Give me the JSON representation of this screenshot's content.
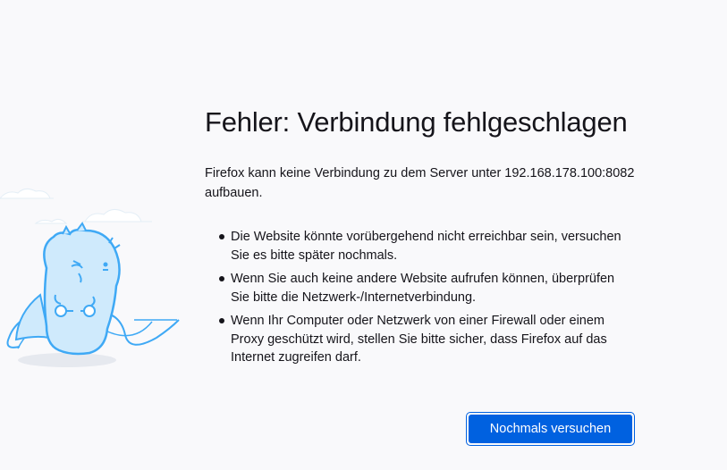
{
  "error": {
    "title": "Fehler: Verbindung fehlgeschlagen",
    "description": "Firefox kann keine Verbindung zu dem Server unter 192.168.178.100:8082 aufbauen.",
    "suggestions": [
      "Die Website könnte vorübergehend nicht erreichbar sein, versuchen Sie es bitte später nochmals.",
      "Wenn Sie auch keine andere Website aufrufen können, überprüfen Sie bitte die Netzwerk-/Internetverbindung.",
      "Wenn Ihr Computer oder Netzwerk von einer Firewall oder einem Proxy geschützt wird, stellen Sie bitte sicher, dass Firefox auf das Internet zugreifen darf."
    ],
    "retry_label": "Nochmals versuchen"
  },
  "colors": {
    "background": "#f9f9fb",
    "accent": "#0061e0",
    "text": "#15141a",
    "illustration_line": "#3fa9f5",
    "illustration_fill": "#cfeafc"
  },
  "illustration": {
    "icon": "unplugged-dino-icon"
  }
}
